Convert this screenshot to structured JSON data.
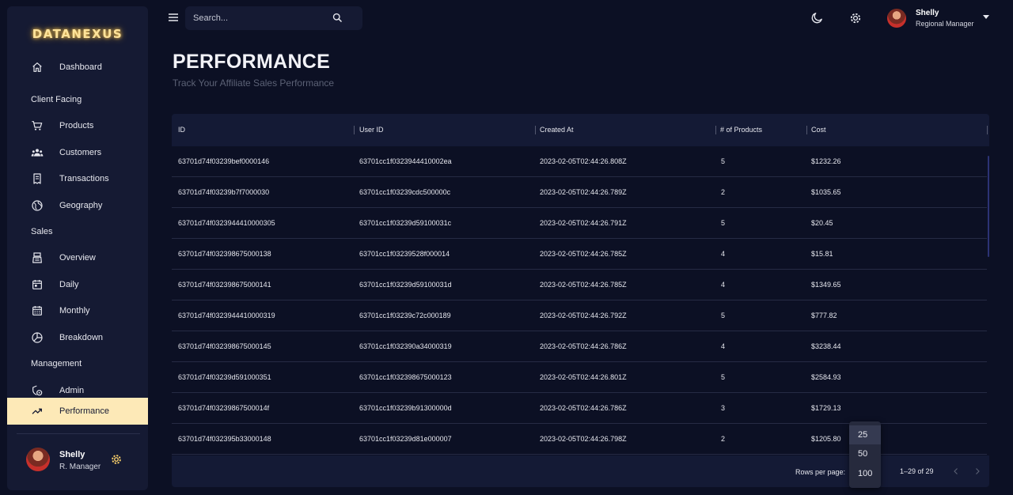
{
  "app": {
    "logo_text": "DATANEXUS"
  },
  "sidebar": {
    "items": [
      {
        "label": "Dashboard",
        "icon": "home-icon"
      },
      {
        "section": "Client Facing"
      },
      {
        "label": "Products",
        "icon": "shopping-cart-icon"
      },
      {
        "label": "Customers",
        "icon": "people-icon"
      },
      {
        "label": "Transactions",
        "icon": "receipt-icon"
      },
      {
        "label": "Geography",
        "icon": "globe-icon"
      },
      {
        "section": "Sales"
      },
      {
        "label": "Overview",
        "icon": "point-of-sale-icon"
      },
      {
        "label": "Daily",
        "icon": "calendar-today-icon"
      },
      {
        "label": "Monthly",
        "icon": "calendar-month-icon"
      },
      {
        "label": "Breakdown",
        "icon": "pie-chart-icon"
      },
      {
        "section": "Management"
      },
      {
        "label": "Admin",
        "icon": "admin-icon"
      },
      {
        "label": "Performance",
        "icon": "trending-up-icon",
        "active": true
      }
    ],
    "user": {
      "name": "Shelly",
      "role": "R. Manager"
    }
  },
  "topbar": {
    "search_placeholder": "Search...",
    "user": {
      "name": "Shelly",
      "role": "Regional Manager"
    }
  },
  "header": {
    "title": "PERFORMANCE",
    "subtitle": "Track Your Affiliate Sales Performance"
  },
  "table": {
    "columns": [
      "ID",
      "User ID",
      "Created At",
      "# of Products",
      "Cost"
    ],
    "rows": [
      [
        "63701d74f03239bef0000146",
        "63701cc1f0323944410002ea",
        "2023-02-05T02:44:26.808Z",
        "5",
        "$1232.26"
      ],
      [
        "63701d74f03239b7f7000030",
        "63701cc1f03239cdc500000c",
        "2023-02-05T02:44:26.789Z",
        "2",
        "$1035.65"
      ],
      [
        "63701d74f0323944410000305",
        "63701cc1f03239d59100031c",
        "2023-02-05T02:44:26.791Z",
        "5",
        "$20.45"
      ],
      [
        "63701d74f032398675000138",
        "63701cc1f03239528f000014",
        "2023-02-05T02:44:26.785Z",
        "4",
        "$15.81"
      ],
      [
        "63701d74f032398675000141",
        "63701cc1f03239d59100031d",
        "2023-02-05T02:44:26.785Z",
        "4",
        "$1349.65"
      ],
      [
        "63701d74f0323944410000319",
        "63701cc1f03239c72c000189",
        "2023-02-05T02:44:26.792Z",
        "5",
        "$777.82"
      ],
      [
        "63701d74f032398675000145",
        "63701cc1f032390a34000319",
        "2023-02-05T02:44:26.786Z",
        "4",
        "$3238.44"
      ],
      [
        "63701d74f03239d591000351",
        "63701cc1f032398675000123",
        "2023-02-05T02:44:26.801Z",
        "5",
        "$2584.93"
      ],
      [
        "63701d74f03239867500014f",
        "63701cc1f03239b91300000d",
        "2023-02-05T02:44:26.786Z",
        "3",
        "$1729.13"
      ],
      [
        "63701d74f032395b33000148",
        "63701cc1f03239d81e000007",
        "2023-02-05T02:44:26.798Z",
        "2",
        "$1205.80"
      ]
    ],
    "footer": {
      "rows_per_page_label": "Rows per page:",
      "rows_per_page_options": [
        "25",
        "50",
        "100"
      ],
      "selected_option": "25",
      "range_text": "1–29 of 29"
    }
  },
  "colors": {
    "background": "#0c1024",
    "panel": "#151a33",
    "accent": "#fde9b7",
    "logo_glow": "#ffd36b"
  }
}
